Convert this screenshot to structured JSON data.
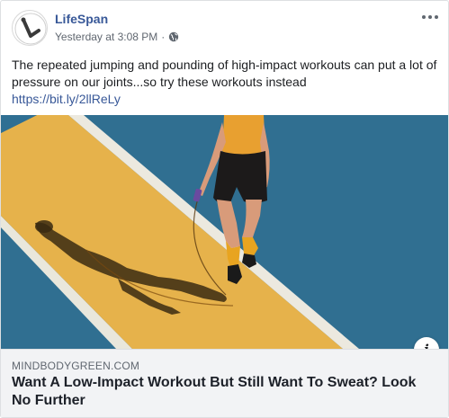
{
  "post": {
    "page_name": "LifeSpan",
    "timestamp": "Yesterday at 3:08 PM",
    "separator": "·",
    "privacy_icon": "globe-icon",
    "more_icon": "more-dots-icon",
    "text": "The repeated jumping and pounding of high-impact workouts can put a lot of pressure on our joints...so try these workouts instead",
    "link_text": "https://bit.ly/2llReLy"
  },
  "link_preview": {
    "domain": "MINDBODYGREEN.COM",
    "title": "Want A Low-Impact Workout But Still Want To Sweat? Look No Further",
    "info_icon": "info-icon",
    "info_glyph": "i"
  },
  "colors": {
    "link_blue": "#385898",
    "track_blue": "#2f6f93",
    "lane_yellow": "#e8b04a",
    "link_box_bg": "#f2f3f5"
  }
}
